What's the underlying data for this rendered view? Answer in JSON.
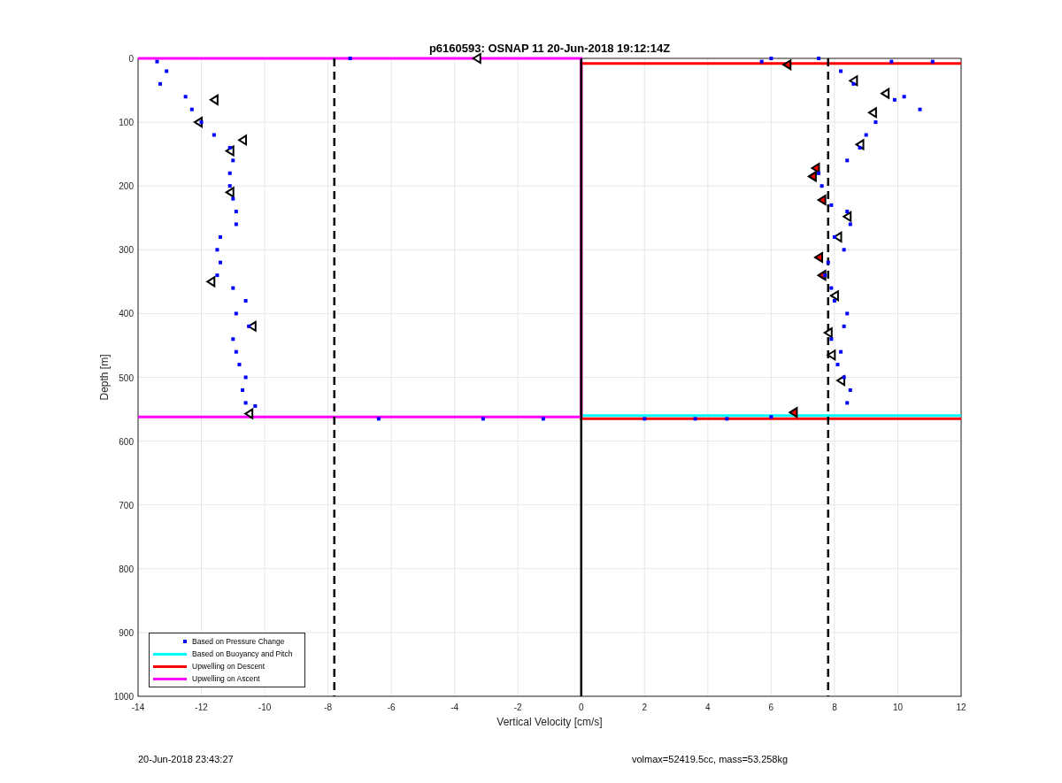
{
  "figure": {
    "chart_data": {
      "type": "scatter",
      "title": "p6160593: OSNAP 11 20-Jun-2018 19:12:14Z",
      "xlabel": "Vertical Velocity [cm/s]",
      "ylabel": "Depth [m]",
      "xlim": [
        -14,
        12
      ],
      "ylim": [
        1000,
        0
      ],
      "xticks": [
        -14,
        -12,
        -10,
        -8,
        -6,
        -4,
        -2,
        0,
        2,
        4,
        6,
        8,
        10,
        12
      ],
      "yticks": [
        0,
        100,
        200,
        300,
        400,
        500,
        600,
        700,
        800,
        900,
        1000
      ],
      "grid": true,
      "legend": true,
      "series": [
        {
          "name": "Based on Pressure Change",
          "color": "#0000ff",
          "type": "scatter",
          "x": [
            -13.4,
            -13.1,
            -13.3,
            -12.5,
            -12.3,
            -12.0,
            -11.6,
            -11.1,
            -11.0,
            -11.1,
            -11.1,
            -11.0,
            -10.9,
            -10.9,
            -11.4,
            -11.5,
            -11.4,
            -11.5,
            -11.0,
            -10.6,
            -10.9,
            -10.5,
            -11.0,
            -10.9,
            -10.8,
            -10.6,
            -10.7,
            -10.6,
            -10.3,
            -7.3,
            -6.4,
            -3.1,
            -1.2,
            2.0,
            3.6,
            4.6,
            6.0,
            5.7,
            6.0,
            7.5,
            9.8,
            11.1,
            8.2,
            8.6,
            9.9,
            10.2,
            10.7,
            9.3,
            9.0,
            8.8,
            8.4,
            7.5,
            7.6,
            7.9,
            8.4,
            8.5,
            8.0,
            8.3,
            7.8,
            7.7,
            7.9,
            8.0,
            8.4,
            8.3,
            7.9,
            8.2,
            8.1,
            8.3,
            8.5,
            8.4
          ],
          "values": [
            5,
            20,
            40,
            60,
            80,
            100,
            120,
            140,
            160,
            180,
            200,
            220,
            240,
            260,
            280,
            300,
            320,
            340,
            360,
            380,
            400,
            420,
            440,
            460,
            480,
            500,
            520,
            540,
            545,
            0,
            565,
            565,
            565,
            565,
            565,
            565,
            562,
            5,
            0,
            0,
            5,
            5,
            20,
            40,
            65,
            60,
            80,
            100,
            120,
            140,
            160,
            180,
            200,
            230,
            240,
            260,
            280,
            300,
            320,
            340,
            360,
            380,
            400,
            420,
            440,
            460,
            480,
            500,
            520,
            540
          ]
        },
        {
          "name": "Based on Buoyancy and Pitch",
          "color": "#00ffff",
          "type": "line",
          "x": [
            0,
            12
          ],
          "values": [
            560,
            560
          ]
        },
        {
          "name": "Upwelling on Descent",
          "color": "#ff0000",
          "type": "line",
          "x": [
            12,
            0,
            0,
            12
          ],
          "values": [
            8,
            8,
            565,
            565
          ]
        },
        {
          "name": "Upwelling on Ascent",
          "color": "#ff00ff",
          "type": "line",
          "x": [
            -14,
            0,
            0,
            -14
          ],
          "values": [
            0,
            0,
            562,
            562
          ]
        },
        {
          "color": "#ffffff",
          "type": "scatter",
          "marker": "triangle",
          "x": [
            -3.3,
            -11.6,
            -12.1,
            -10.7,
            -11.1,
            -11.1,
            -11.7,
            -10.4,
            -10.5,
            8.6,
            9.6,
            9.2,
            8.8,
            8.4,
            8.1,
            8.0,
            7.8,
            7.9,
            8.2
          ],
          "values": [
            0,
            65,
            100,
            128,
            145,
            210,
            350,
            420,
            557,
            35,
            55,
            85,
            135,
            248,
            280,
            372,
            430,
            465,
            505
          ]
        },
        {
          "color": "#ff0000",
          "type": "scatter",
          "marker": "triangle",
          "x": [
            6.5,
            7.4,
            7.3,
            7.6,
            7.5,
            7.6,
            6.7
          ],
          "values": [
            10,
            172,
            185,
            222,
            312,
            340,
            555
          ]
        }
      ],
      "ref_lines": [
        {
          "axis": "x",
          "value": -7.8
        },
        {
          "axis": "x",
          "value": 7.8
        },
        {
          "axis": "x",
          "value": 0
        }
      ]
    }
  },
  "footer": {
    "timestamp": "20-Jun-2018 23:43:27",
    "info": "volmax=52419.5cc, mass=53.258kg"
  }
}
